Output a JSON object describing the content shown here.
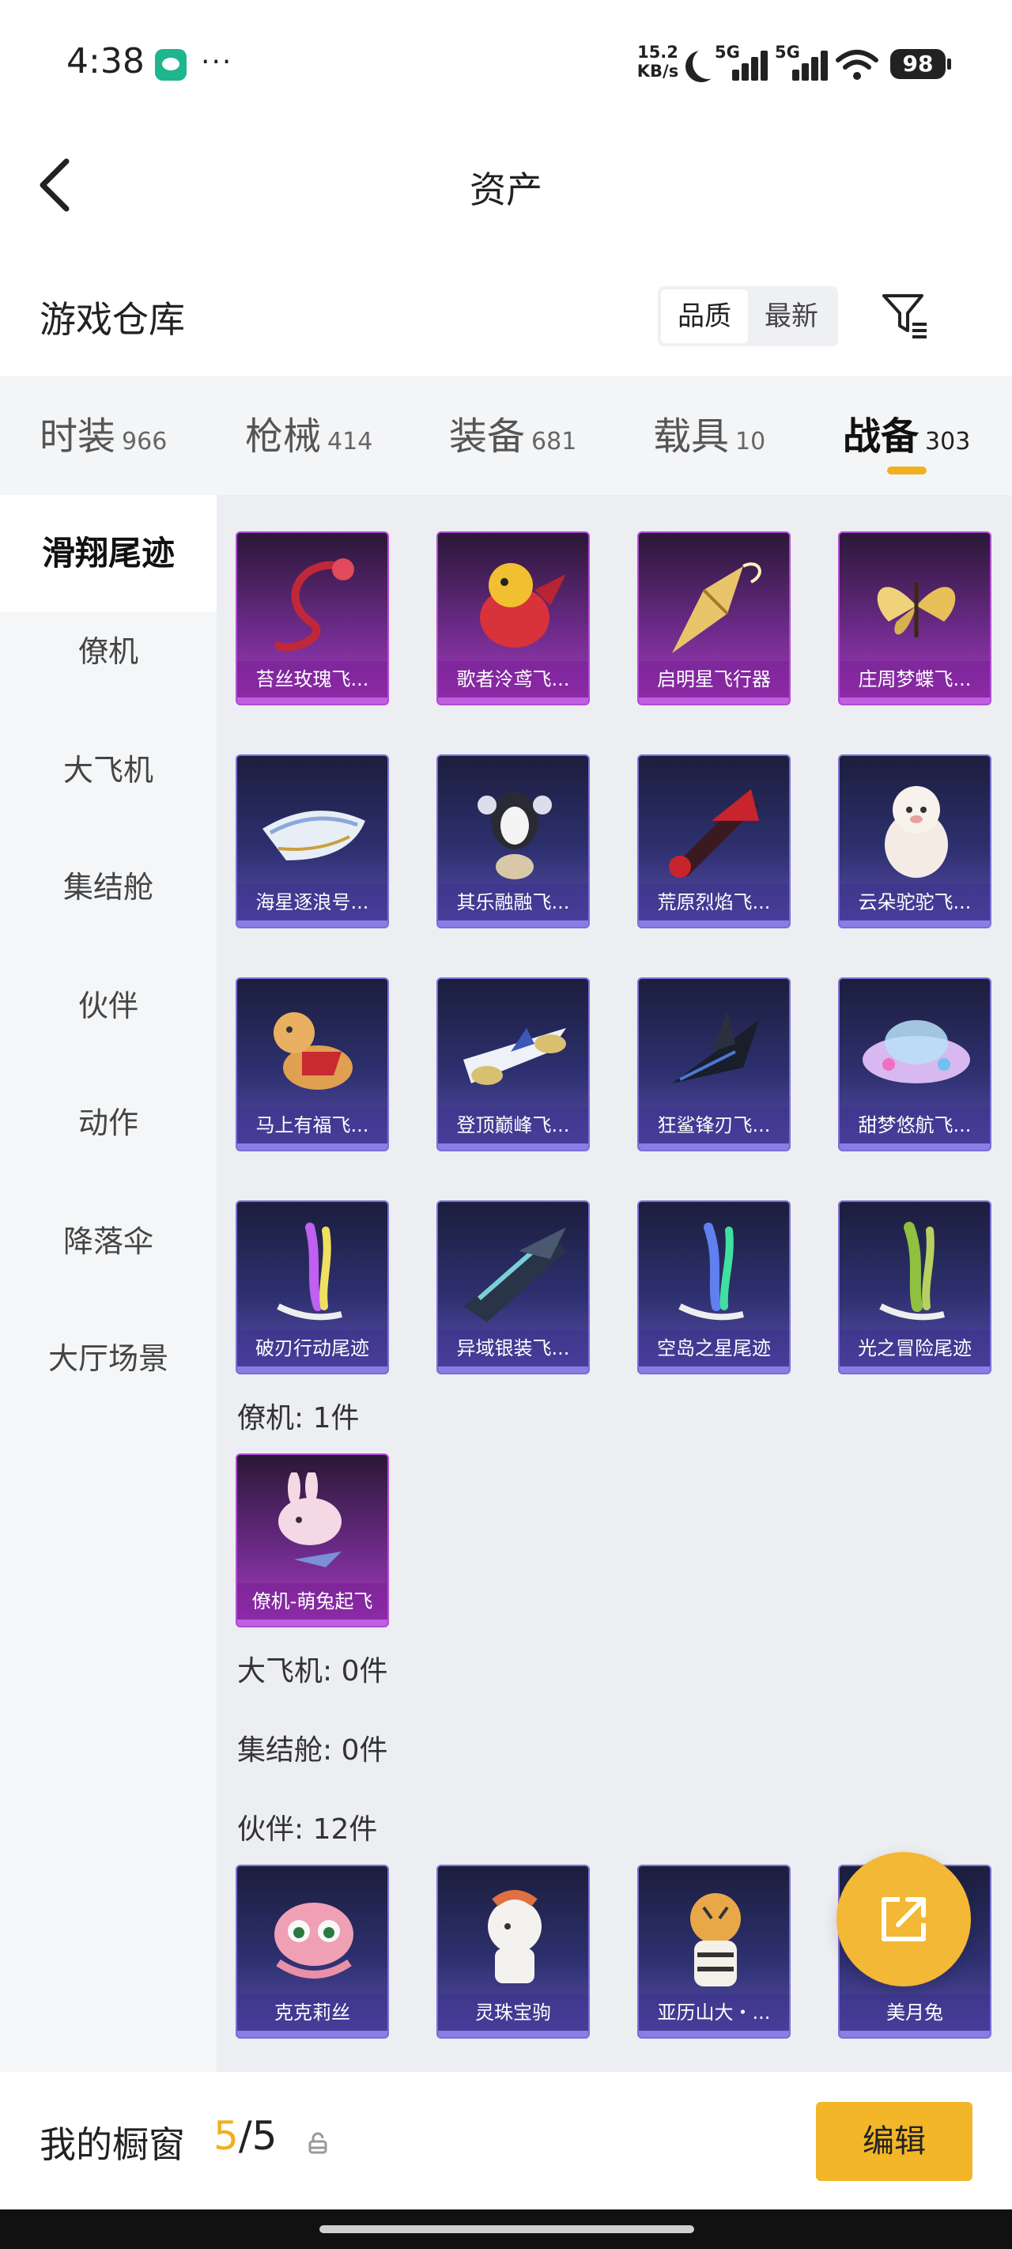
{
  "status_bar": {
    "time": "4:38",
    "more": "···",
    "net_speed_value": "15.2",
    "net_speed_unit": "KB/s",
    "signal1_label": "5G",
    "signal2_label": "5G",
    "battery": "98"
  },
  "nav": {
    "title": "资产"
  },
  "warehouse": {
    "title": "游戏仓库",
    "sort_options": [
      "品质",
      "最新"
    ],
    "sort_selected": "品质"
  },
  "tabs": [
    {
      "label": "时装",
      "count": "966"
    },
    {
      "label": "枪械",
      "count": "414"
    },
    {
      "label": "装备",
      "count": "681"
    },
    {
      "label": "载具",
      "count": "10"
    },
    {
      "label": "战备",
      "count": "303",
      "active": true
    }
  ],
  "sidebar": {
    "items": [
      "滑翔尾迹",
      "僚机",
      "大飞机",
      "集结舱",
      "伙伴",
      "动作",
      "降落伞",
      "大厅场景"
    ],
    "active": "滑翔尾迹"
  },
  "sections": {
    "glide_trail_items": [
      {
        "name": "苔丝玫瑰飞...",
        "rarity": "purple",
        "icon": "rose-glider-icon"
      },
      {
        "name": "歌者泠鸢飞...",
        "rarity": "purple",
        "icon": "red-bird-glider-icon"
      },
      {
        "name": "启明星飞行器",
        "rarity": "purple",
        "icon": "golden-glider-icon"
      },
      {
        "name": "庄周梦蝶飞...",
        "rarity": "purple",
        "icon": "butterfly-glider-icon"
      },
      {
        "name": "海星逐浪号...",
        "rarity": "blue",
        "icon": "boat-glider-icon"
      },
      {
        "name": "其乐融融飞...",
        "rarity": "blue",
        "icon": "penguin-glider-icon"
      },
      {
        "name": "荒原烈焰飞...",
        "rarity": "blue",
        "icon": "flame-glider-icon"
      },
      {
        "name": "云朵驼驼飞...",
        "rarity": "blue",
        "icon": "alpaca-glider-icon"
      },
      {
        "name": "马上有福飞...",
        "rarity": "blue",
        "icon": "horse-glider-icon"
      },
      {
        "name": "登顶巅峰飞...",
        "rarity": "blue",
        "icon": "jet-glider-icon"
      },
      {
        "name": "狂鲨锋刃飞...",
        "rarity": "blue",
        "icon": "shark-glider-icon"
      },
      {
        "name": "甜梦悠航飞...",
        "rarity": "blue",
        "icon": "ufo-glider-icon"
      },
      {
        "name": "破刃行动尾迹",
        "rarity": "blue",
        "icon": "smoke-trail-icon"
      },
      {
        "name": "异域银装飞...",
        "rarity": "blue",
        "icon": "alien-glider-icon"
      },
      {
        "name": "空岛之星尾迹",
        "rarity": "blue",
        "icon": "smoke-trail-icon"
      },
      {
        "name": "光之冒险尾迹",
        "rarity": "blue",
        "icon": "smoke-trail-icon"
      }
    ],
    "wingman_label": "僚机: 1件",
    "wingman_items": [
      {
        "name": "僚机-萌兔起飞",
        "rarity": "purple",
        "icon": "bunny-wingman-icon"
      }
    ],
    "big_plane_label": "大飞机: 0件",
    "assembly_label": "集结舱: 0件",
    "partner_label": "伙伴: 12件",
    "partner_items": [
      {
        "name": "克克莉丝",
        "rarity": "blue",
        "icon": "octopus-partner-icon"
      },
      {
        "name": "灵珠宝驹",
        "rarity": "blue",
        "icon": "pony-partner-icon"
      },
      {
        "name": "亚历山大・...",
        "rarity": "blue",
        "icon": "tiger-partner-icon"
      },
      {
        "name": "美月兔",
        "rarity": "blue",
        "icon": "rabbit-partner-icon"
      }
    ]
  },
  "bottom_bar": {
    "title": "我的橱窗",
    "count_current": "5",
    "count_sep_total": "/5",
    "edit_label": "编辑"
  },
  "colors": {
    "accent": "#f2b628",
    "purple_rarity": "#b04cd2",
    "blue_rarity": "#7a6ed6"
  }
}
